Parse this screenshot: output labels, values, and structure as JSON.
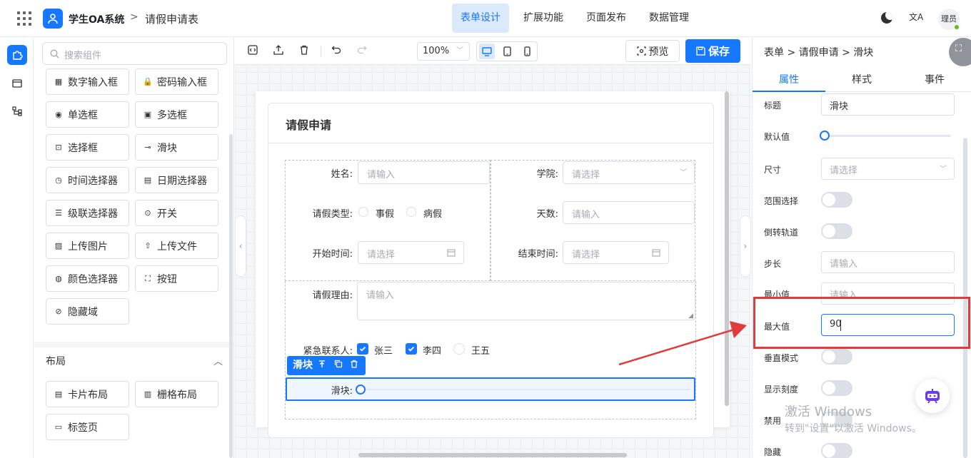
{
  "header": {
    "app_name": "学生OA系统",
    "separator": ">",
    "page_title": "请假申请表",
    "nav": [
      {
        "label": "表单设计",
        "active": true
      },
      {
        "label": "扩展功能",
        "active": false
      },
      {
        "label": "页面发布",
        "active": false
      },
      {
        "label": "数据管理",
        "active": false
      }
    ],
    "translate_glyph": "文A",
    "user_avatar_text": "理员"
  },
  "component_panel": {
    "search_placeholder": "搜索组件",
    "items": [
      {
        "label": "数字输入框",
        "icon": "number-input-icon",
        "glyph": "▦"
      },
      {
        "label": "密码输入框",
        "icon": "lock-icon",
        "glyph": "🔒"
      },
      {
        "label": "单选框",
        "icon": "radio-icon",
        "glyph": "◉"
      },
      {
        "label": "多选框",
        "icon": "checkbox-icon",
        "glyph": "▣"
      },
      {
        "label": "选择框",
        "icon": "select-icon",
        "glyph": "⊡"
      },
      {
        "label": "滑块",
        "icon": "slider-icon",
        "glyph": "⊸"
      },
      {
        "label": "时间选择器",
        "icon": "clock-icon",
        "glyph": "◷"
      },
      {
        "label": "日期选择器",
        "icon": "calendar-icon",
        "glyph": "▤"
      },
      {
        "label": "级联选择器",
        "icon": "cascader-icon",
        "glyph": "☰"
      },
      {
        "label": "开关",
        "icon": "switch-icon",
        "glyph": "⊙"
      },
      {
        "label": "上传图片",
        "icon": "image-icon",
        "glyph": "▨"
      },
      {
        "label": "上传文件",
        "icon": "upload-icon",
        "glyph": "⇧"
      },
      {
        "label": "颜色选择器",
        "icon": "palette-icon",
        "glyph": "◍"
      },
      {
        "label": "按钮",
        "icon": "button-icon",
        "glyph": "⛶"
      },
      {
        "label": "隐藏域",
        "icon": "eye-off-icon",
        "glyph": "⊘"
      }
    ],
    "layout_section": {
      "title": "布局",
      "items": [
        {
          "label": "卡片布局",
          "icon": "card-icon",
          "glyph": "▤"
        },
        {
          "label": "栅格布局",
          "icon": "grid-layout-icon",
          "glyph": "▥"
        },
        {
          "label": "标签页",
          "icon": "tabs-icon",
          "glyph": "▭"
        }
      ]
    }
  },
  "toolbar": {
    "zoom": "100%",
    "preview_label": "预览",
    "save_label": "保存"
  },
  "form": {
    "card_title": "请假申请",
    "fields": {
      "name_label": "姓名:",
      "name_placeholder": "请输入",
      "college_label": "学院:",
      "college_placeholder": "请选择",
      "leave_type_label": "请假类型:",
      "leave_type_options": [
        "事假",
        "病假"
      ],
      "days_label": "天数:",
      "days_placeholder": "请输入",
      "start_label": "开始时间:",
      "start_placeholder": "请选择",
      "end_label": "结束时间:",
      "end_placeholder": "请选择",
      "reason_label": "请假理由:",
      "reason_placeholder": "请输入",
      "contact_label": "紧急联系人:",
      "contact_options": [
        {
          "label": "张三",
          "checked": true
        },
        {
          "label": "李四",
          "checked": true
        },
        {
          "label": "王五",
          "checked": false
        }
      ],
      "slider_label": "滑块:",
      "slider_value": 0
    },
    "selected_tag": "滑块"
  },
  "properties": {
    "breadcrumb": "表单 > 请假申请 > 滑块",
    "tabs": [
      {
        "label": "属性",
        "active": true
      },
      {
        "label": "样式",
        "active": false
      },
      {
        "label": "事件",
        "active": false
      }
    ],
    "title_label": "标题",
    "title_value": "滑块",
    "default_label": "默认值",
    "default_value": 0,
    "size_label": "尺寸",
    "size_placeholder": "请选择",
    "range_label": "范围选择",
    "range_on": false,
    "reverse_label": "倒转轨道",
    "reverse_on": false,
    "step_label": "步长",
    "step_placeholder": "请输入",
    "min_label": "最小值",
    "min_placeholder": "请输入",
    "max_label": "最大值",
    "max_value": "90",
    "vertical_label": "垂直模式",
    "vertical_on": false,
    "ticks_label": "显示刻度",
    "ticks_on": false,
    "disabled_label": "禁用",
    "disabled_on": false,
    "hidden_label": "隐藏",
    "hidden_on": false
  },
  "watermark": {
    "line1": "激活 Windows",
    "line2": "转到\"设置\"以激活 Windows。"
  },
  "colors": {
    "primary": "#1677ff",
    "annotation": "#e03c3c"
  }
}
